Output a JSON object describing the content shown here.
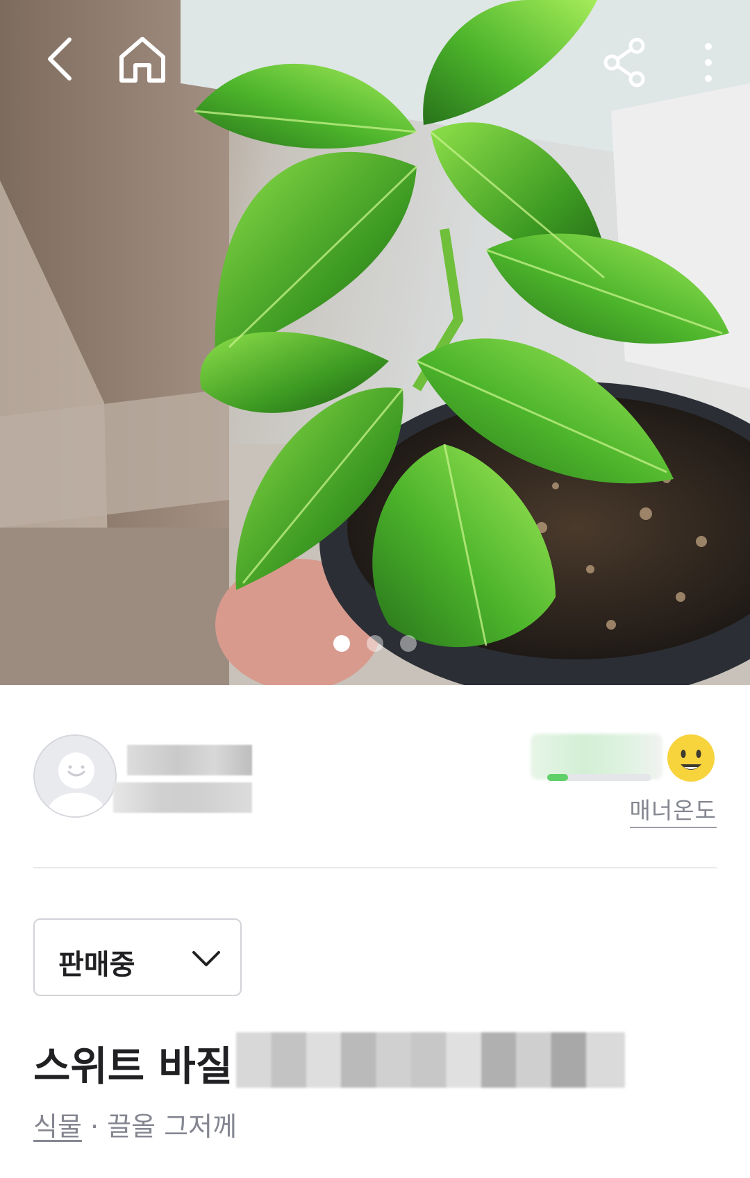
{
  "header": {
    "icons": [
      "back-icon",
      "home-icon",
      "share-icon",
      "more-vertical-icon"
    ]
  },
  "gallery": {
    "total_images": 3,
    "current_index": 1
  },
  "seller": {
    "name": "",
    "location": "",
    "manner_temperature_text": "",
    "manner_level": 0.2,
    "manner_label": "매너온도",
    "manner_face_icon": "smiling-face-icon"
  },
  "post": {
    "status": "판매중",
    "title_visible": "스위트 바질",
    "category": "식물",
    "separator": " · ",
    "time_info": "끌올 그저께"
  },
  "colors": {
    "accent_green": "#5fd068",
    "text_primary": "#212124",
    "text_secondary": "#848690",
    "face_yellow": "#f7d33c"
  }
}
